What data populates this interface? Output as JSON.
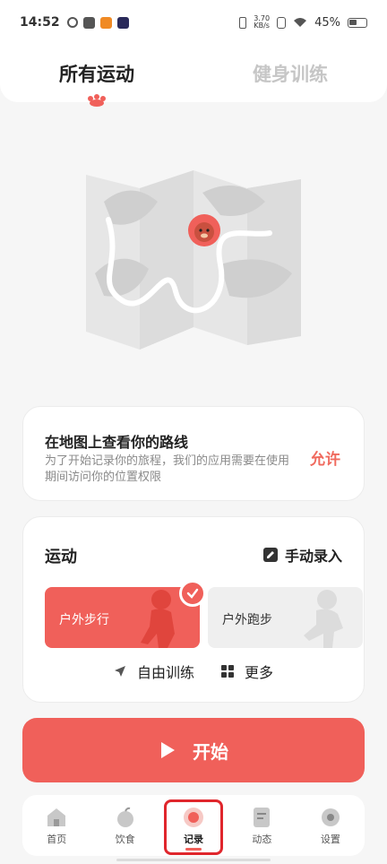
{
  "status_bar": {
    "time": "14:52",
    "net_speed_value": "3.70",
    "net_speed_unit": "KB/s",
    "battery": "45%"
  },
  "tabs": [
    {
      "label": "所有运动",
      "active": true
    },
    {
      "label": "健身训练",
      "active": false
    }
  ],
  "permission_card": {
    "title": "在地图上查看你的路线",
    "description": "为了开始记录你的旅程，我们的应用需要在使用期间访问你的位置权限",
    "allow_label": "允许"
  },
  "sport_card": {
    "title": "运动",
    "manual_entry_label": "手动录入",
    "options": [
      {
        "label": "户外步行",
        "selected": true
      },
      {
        "label": "户外跑步",
        "selected": false
      }
    ],
    "free_training_label": "自由训练",
    "more_label": "更多"
  },
  "start_button": {
    "label": "开始"
  },
  "bottom_nav": [
    {
      "label": "首页",
      "icon": "home-icon",
      "active": false
    },
    {
      "label": "饮食",
      "icon": "apple-icon",
      "active": false
    },
    {
      "label": "记录",
      "icon": "record-icon",
      "active": true
    },
    {
      "label": "动态",
      "icon": "feed-icon",
      "active": false
    },
    {
      "label": "设置",
      "icon": "gear-icon",
      "active": false
    }
  ],
  "colors": {
    "accent": "#f0605a",
    "highlight_frame": "#e0262c",
    "inactive_tab": "#c6c6c6"
  }
}
